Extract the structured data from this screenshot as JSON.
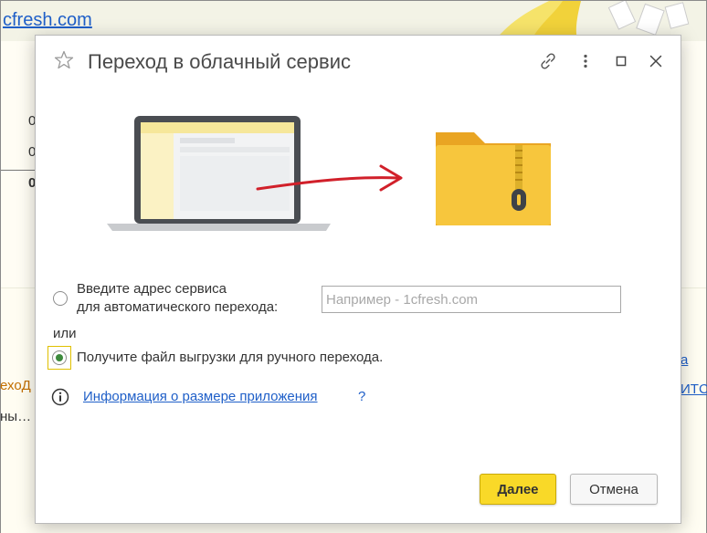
{
  "background": {
    "top_link": "cfresh.com",
    "numbers": [
      "0",
      "0",
      "0"
    ],
    "left_orange_text": "ехоД",
    "left_dark_text": "ны…",
    "right_link_1": "а",
    "right_link_2": "ИТС"
  },
  "dialog": {
    "title": "Переход в облачный сервис",
    "options": {
      "auto_label_line1": "Введите адрес сервиса",
      "auto_label_line2": "для автоматического перехода:",
      "address_placeholder": "Например - 1cfresh.com",
      "address_value": "",
      "or_label": "или",
      "manual_label": "Получите файл выгрузки для ручного перехода.",
      "selected": "manual"
    },
    "info_link": "Информация о размере приложения",
    "info_question": "?",
    "buttons": {
      "next": "Далее",
      "cancel": "Отмена"
    }
  },
  "colors": {
    "accent_button": "#f9d928",
    "link": "#1f5fc8",
    "folder": "#f5c338",
    "arrow": "#d1202a",
    "radio_selected": "#3c8a3c"
  },
  "icons": [
    "star-icon",
    "link-icon",
    "more-icon",
    "maximize-icon",
    "close-icon",
    "info-icon",
    "laptop-icon",
    "arrow-icon",
    "zip-folder-icon"
  ]
}
